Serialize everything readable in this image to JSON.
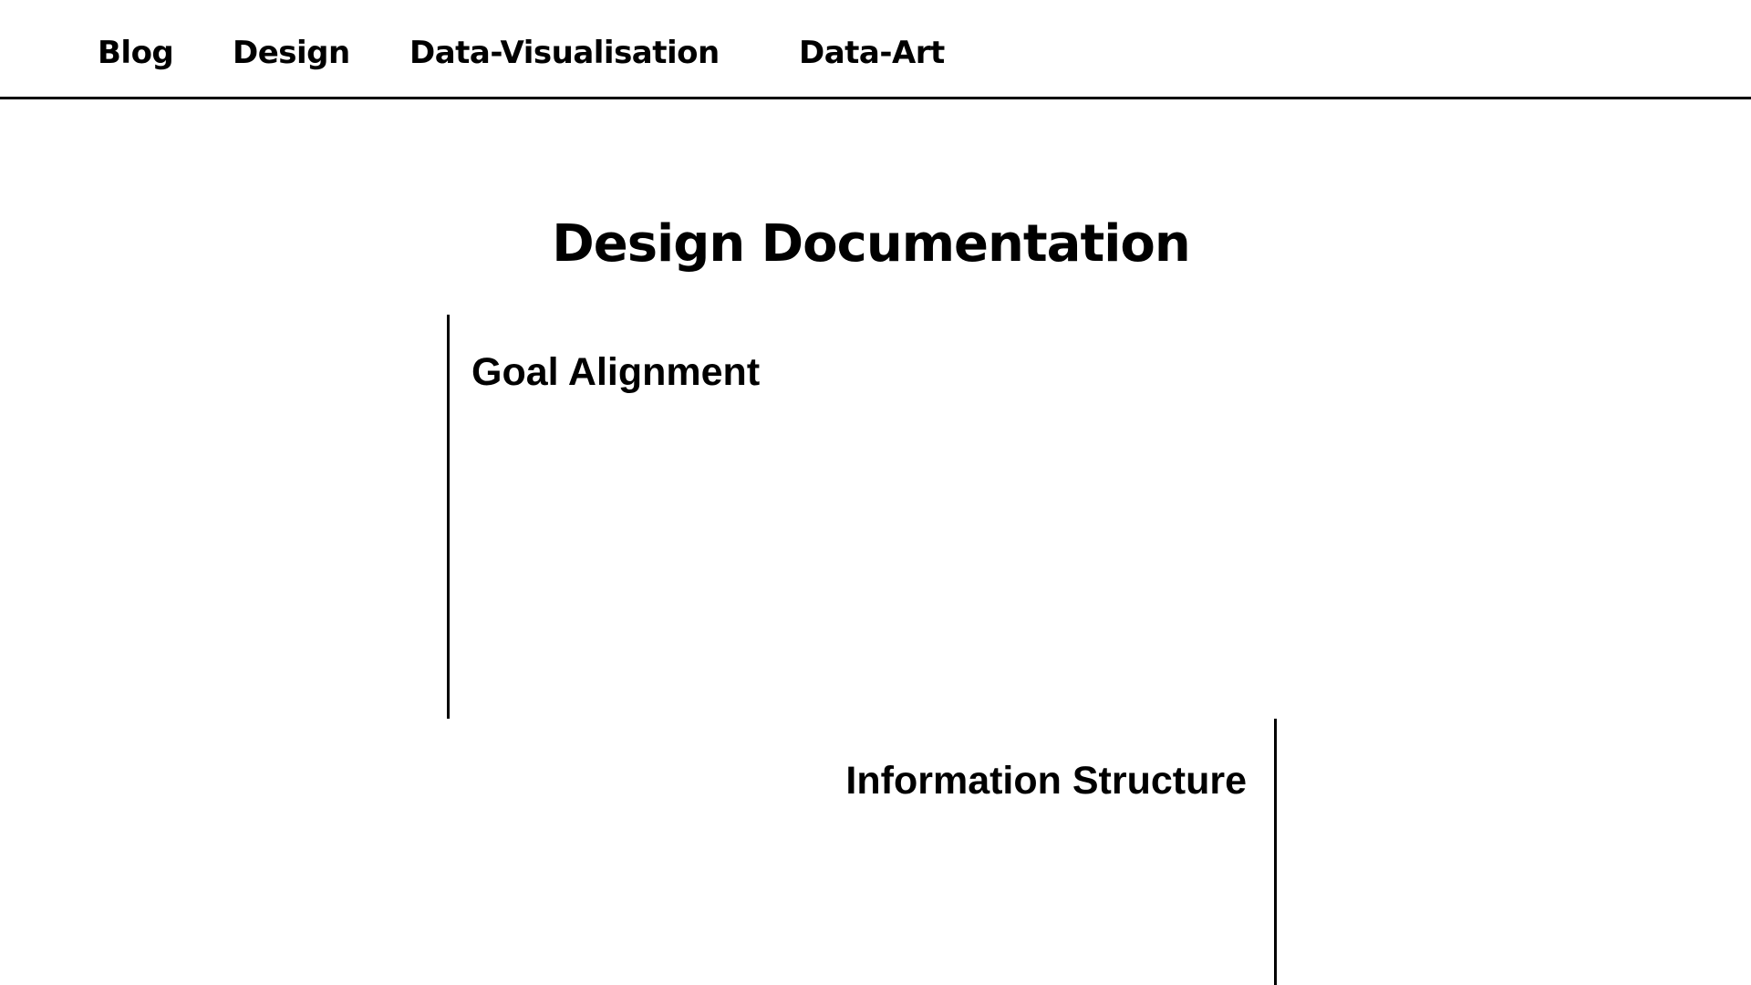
{
  "nav": {
    "items": [
      {
        "label": "Blog"
      },
      {
        "label": "Design"
      },
      {
        "label": "Data-Visualisation"
      },
      {
        "label": "Data-Art"
      }
    ]
  },
  "page": {
    "title": "Design Documentation"
  },
  "sections": [
    {
      "heading": "Goal Alignment"
    },
    {
      "heading": "Information Structure"
    }
  ],
  "colors": {
    "background": "#ffffff",
    "text": "#000000",
    "rule": "#000000"
  }
}
